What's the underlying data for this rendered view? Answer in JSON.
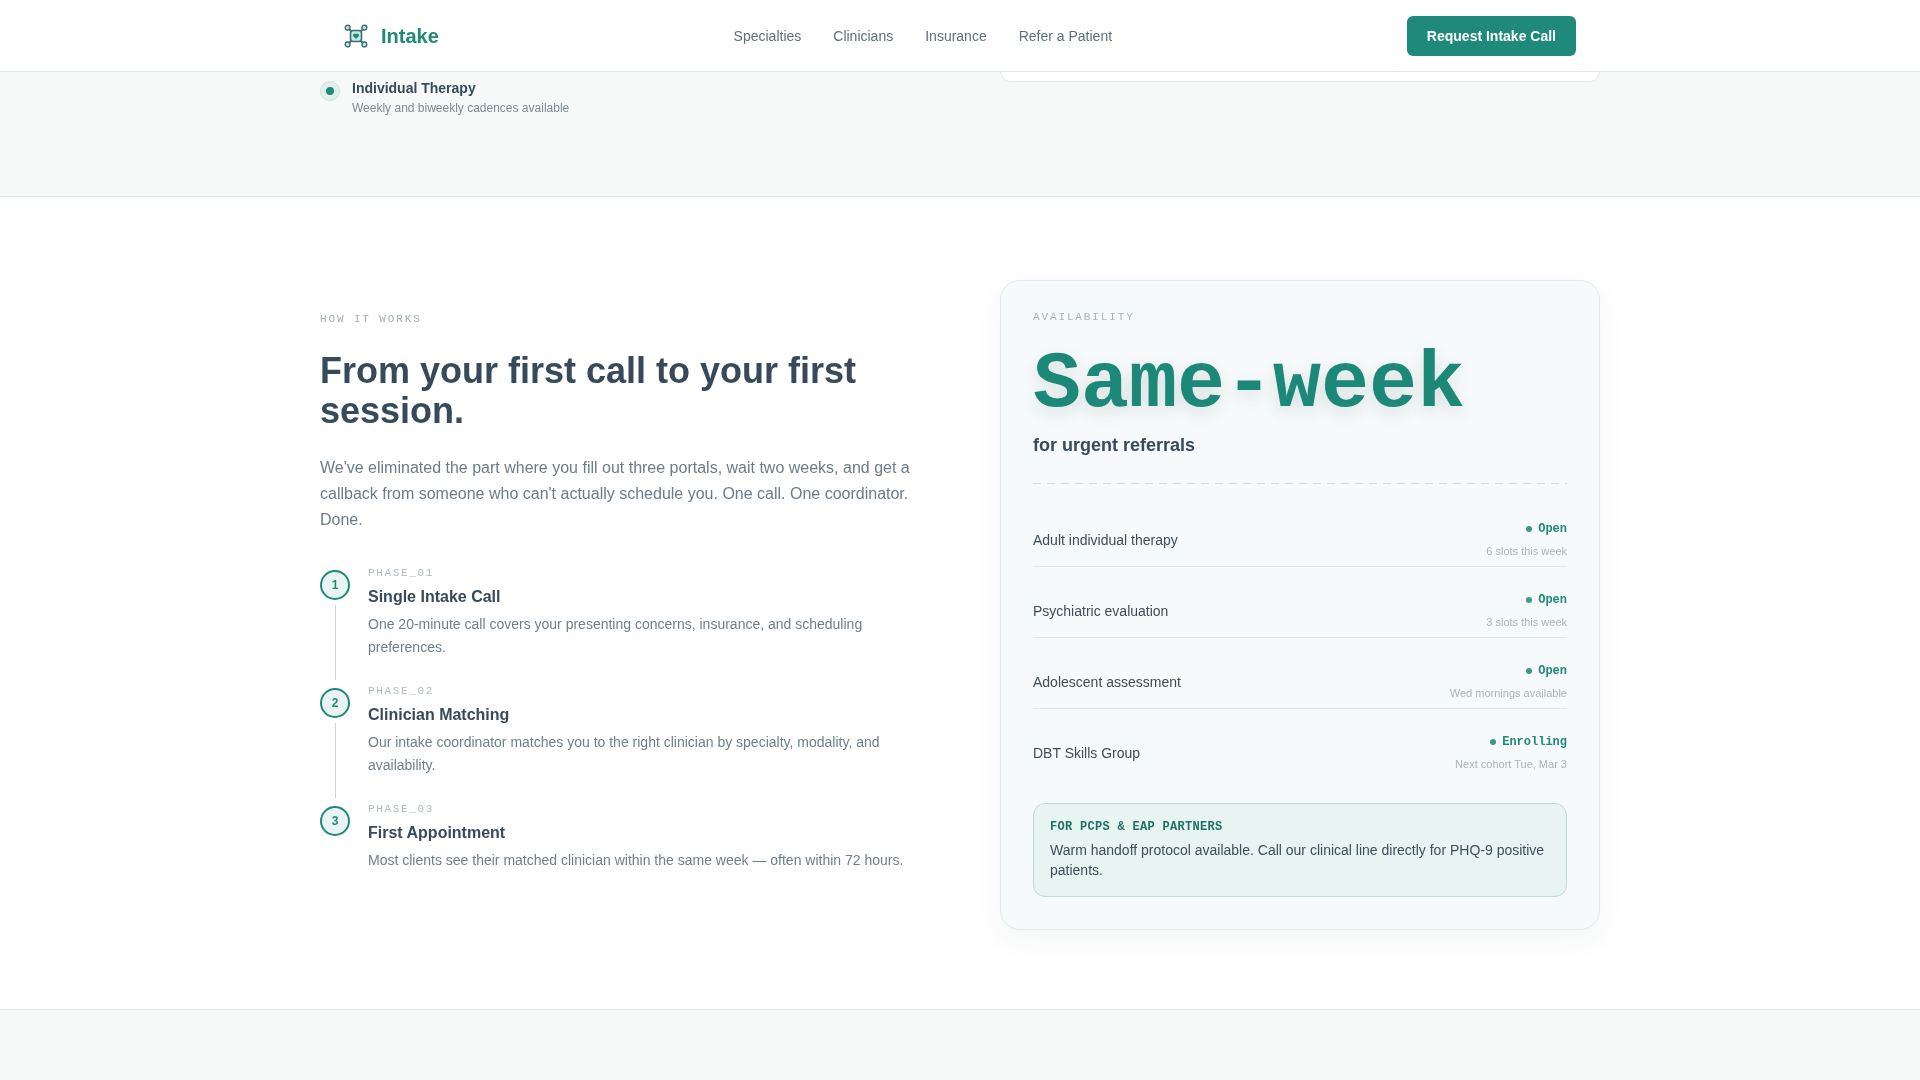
{
  "header": {
    "brand": "Intake",
    "nav": [
      "Specialties",
      "Clinicians",
      "Insurance",
      "Refer a Patient"
    ],
    "cta": "Request Intake Call"
  },
  "service_options": [
    {
      "title": "Individual Therapy",
      "subtitle": "Weekly and biweekly cadences available",
      "selected": true
    }
  ],
  "how_it_works": {
    "eyebrow": "HOW IT WORKS",
    "heading": "From your first call to your first session.",
    "intro": "We've eliminated the part where you fill out three portals, wait two weeks, and get a callback from someone who can't actually schedule you. One call. One coordinator. Done.",
    "steps": [
      {
        "number": "1",
        "phase": "PHASE_01",
        "title": "Single Intake Call",
        "description": "One 20-minute call covers your presenting concerns, insurance, and scheduling preferences."
      },
      {
        "number": "2",
        "phase": "PHASE_02",
        "title": "Clinician Matching",
        "description": "Our intake coordinator matches you to the right clinician by specialty, modality, and availability."
      },
      {
        "number": "3",
        "phase": "PHASE_03",
        "title": "First Appointment",
        "description": "Most clients see their matched clinician within the same week — often within 72 hours."
      }
    ]
  },
  "availability": {
    "eyebrow": "AVAILABILITY",
    "headline": "Same-week",
    "subheadline": "for urgent referrals",
    "services": [
      {
        "name": "Adult individual therapy",
        "status": "Open",
        "detail": "6 slots this week"
      },
      {
        "name": "Psychiatric evaluation",
        "status": "Open",
        "detail": "3 slots this week"
      },
      {
        "name": "Adolescent assessment",
        "status": "Open",
        "detail": "Wed mornings available"
      },
      {
        "name": "DBT Skills Group",
        "status": "Enrolling",
        "detail": "Next cohort Tue, Mar 3"
      }
    ],
    "callout": {
      "title": "FOR PCPS & EAP PARTNERS",
      "text": "Warm handoff protocol available. Call our clinical line directly for PHQ-9 positive patients."
    }
  }
}
